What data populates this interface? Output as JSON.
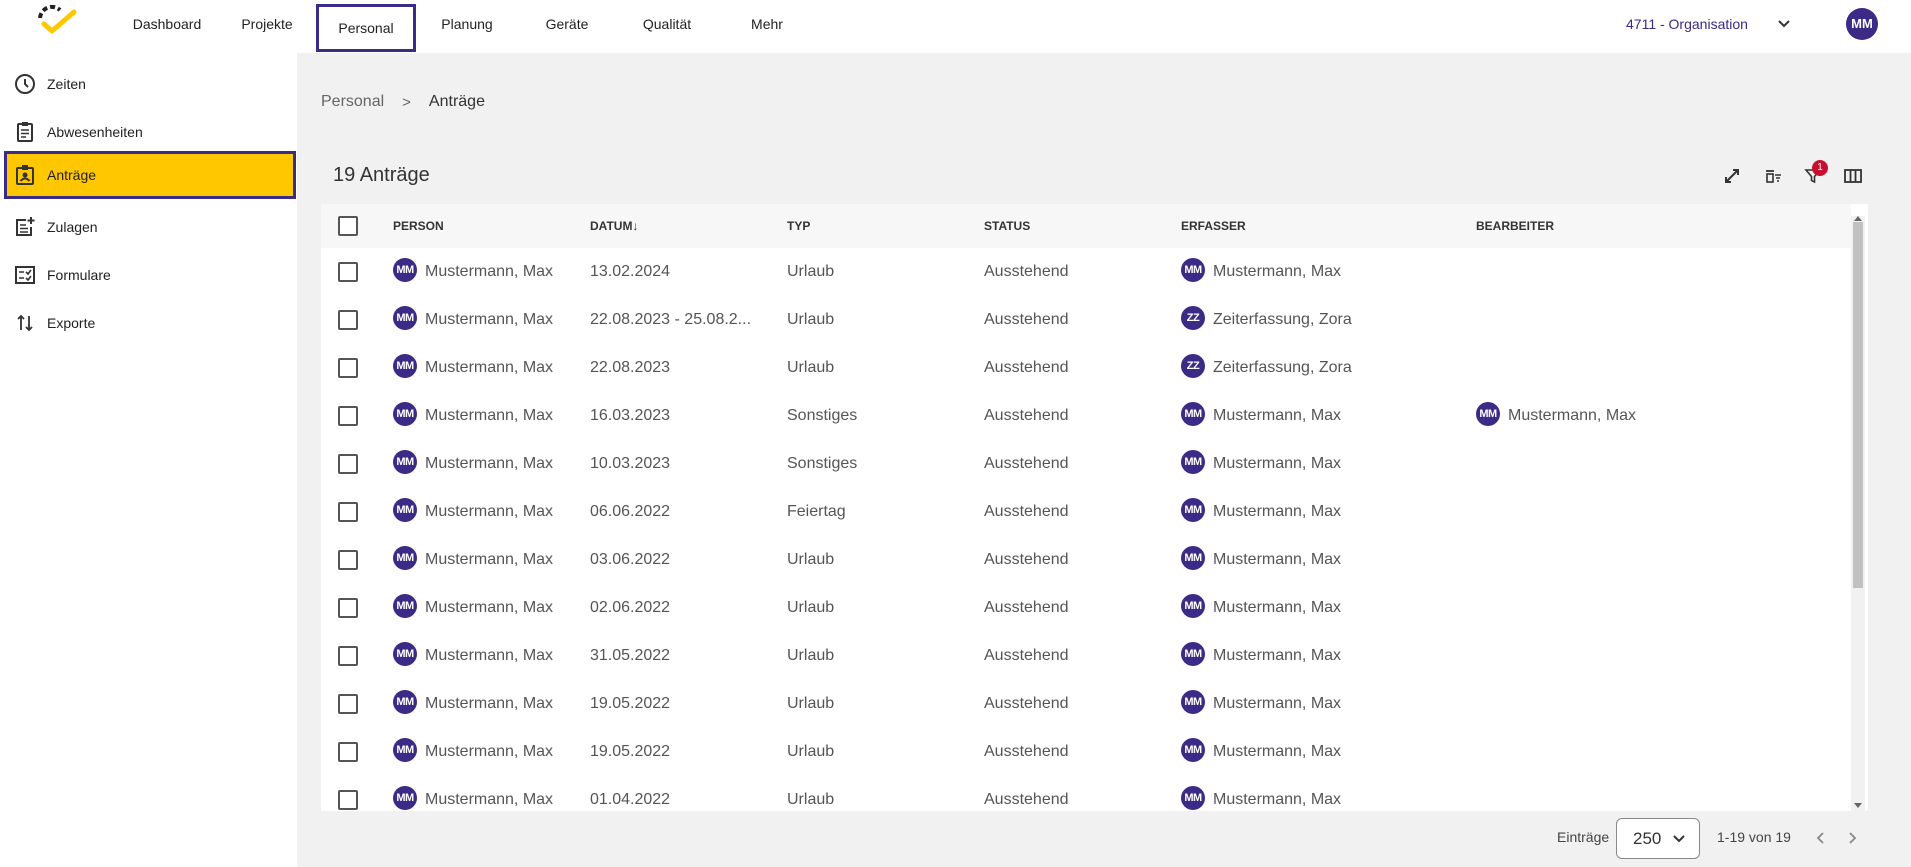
{
  "topnav": {
    "items": [
      "Dashboard",
      "Projekte",
      "Personal",
      "Planung",
      "Geräte",
      "Qualität",
      "Mehr"
    ],
    "active": "Personal",
    "org": "4711 - Organisation",
    "user_initials": "MM"
  },
  "sidebar": {
    "items": [
      {
        "label": "Zeiten",
        "icon": "clock-icon"
      },
      {
        "label": "Abwesenheiten",
        "icon": "clipboard-icon"
      },
      {
        "label": "Anträge",
        "icon": "badge-icon"
      },
      {
        "label": "Zulagen",
        "icon": "post-add-icon"
      },
      {
        "label": "Formulare",
        "icon": "checklist-icon"
      },
      {
        "label": "Exporte",
        "icon": "swap-vert-icon"
      }
    ],
    "active": "Anträge"
  },
  "breadcrumb": {
    "parent": "Personal",
    "separator": ">",
    "current": "Anträge"
  },
  "card": {
    "title": "19 Anträge",
    "filter_count": "1"
  },
  "colors": {
    "accent": "#3b2a86",
    "highlight": "#ffc700",
    "badge": "#c8102e"
  },
  "table": {
    "columns": [
      "PERSON",
      "DATUM↓",
      "TYP",
      "STATUS",
      "ERFASSER",
      "BEARBEITER"
    ],
    "rows": [
      {
        "person_initials": "MM",
        "person": "Mustermann, Max",
        "datum": "13.02.2024",
        "typ": "Urlaub",
        "status": "Ausstehend",
        "erfasser_initials": "MM",
        "erfasser": "Mustermann, Max",
        "bearbeiter_initials": "",
        "bearbeiter": ""
      },
      {
        "person_initials": "MM",
        "person": "Mustermann, Max",
        "datum": "22.08.2023 - 25.08.2...",
        "typ": "Urlaub",
        "status": "Ausstehend",
        "erfasser_initials": "ZZ",
        "erfasser": "Zeiterfassung, Zora",
        "bearbeiter_initials": "",
        "bearbeiter": ""
      },
      {
        "person_initials": "MM",
        "person": "Mustermann, Max",
        "datum": "22.08.2023",
        "typ": "Urlaub",
        "status": "Ausstehend",
        "erfasser_initials": "ZZ",
        "erfasser": "Zeiterfassung, Zora",
        "bearbeiter_initials": "",
        "bearbeiter": ""
      },
      {
        "person_initials": "MM",
        "person": "Mustermann, Max",
        "datum": "16.03.2023",
        "typ": "Sonstiges",
        "status": "Ausstehend",
        "erfasser_initials": "MM",
        "erfasser": "Mustermann, Max",
        "bearbeiter_initials": "MM",
        "bearbeiter": "Mustermann, Max"
      },
      {
        "person_initials": "MM",
        "person": "Mustermann, Max",
        "datum": "10.03.2023",
        "typ": "Sonstiges",
        "status": "Ausstehend",
        "erfasser_initials": "MM",
        "erfasser": "Mustermann, Max",
        "bearbeiter_initials": "",
        "bearbeiter": ""
      },
      {
        "person_initials": "MM",
        "person": "Mustermann, Max",
        "datum": "06.06.2022",
        "typ": "Feiertag",
        "status": "Ausstehend",
        "erfasser_initials": "MM",
        "erfasser": "Mustermann, Max",
        "bearbeiter_initials": "",
        "bearbeiter": ""
      },
      {
        "person_initials": "MM",
        "person": "Mustermann, Max",
        "datum": "03.06.2022",
        "typ": "Urlaub",
        "status": "Ausstehend",
        "erfasser_initials": "MM",
        "erfasser": "Mustermann, Max",
        "bearbeiter_initials": "",
        "bearbeiter": ""
      },
      {
        "person_initials": "MM",
        "person": "Mustermann, Max",
        "datum": "02.06.2022",
        "typ": "Urlaub",
        "status": "Ausstehend",
        "erfasser_initials": "MM",
        "erfasser": "Mustermann, Max",
        "bearbeiter_initials": "",
        "bearbeiter": ""
      },
      {
        "person_initials": "MM",
        "person": "Mustermann, Max",
        "datum": "31.05.2022",
        "typ": "Urlaub",
        "status": "Ausstehend",
        "erfasser_initials": "MM",
        "erfasser": "Mustermann, Max",
        "bearbeiter_initials": "",
        "bearbeiter": ""
      },
      {
        "person_initials": "MM",
        "person": "Mustermann, Max",
        "datum": "19.05.2022",
        "typ": "Urlaub",
        "status": "Ausstehend",
        "erfasser_initials": "MM",
        "erfasser": "Mustermann, Max",
        "bearbeiter_initials": "",
        "bearbeiter": ""
      },
      {
        "person_initials": "MM",
        "person": "Mustermann, Max",
        "datum": "19.05.2022",
        "typ": "Urlaub",
        "status": "Ausstehend",
        "erfasser_initials": "MM",
        "erfasser": "Mustermann, Max",
        "bearbeiter_initials": "",
        "bearbeiter": ""
      },
      {
        "person_initials": "MM",
        "person": "Mustermann, Max",
        "datum": "01.04.2022",
        "typ": "Urlaub",
        "status": "Ausstehend",
        "erfasser_initials": "MM",
        "erfasser": "Mustermann, Max",
        "bearbeiter_initials": "",
        "bearbeiter": ""
      }
    ]
  },
  "pagination": {
    "label": "Einträge",
    "page_size": "250",
    "range": "1-19 von 19"
  }
}
